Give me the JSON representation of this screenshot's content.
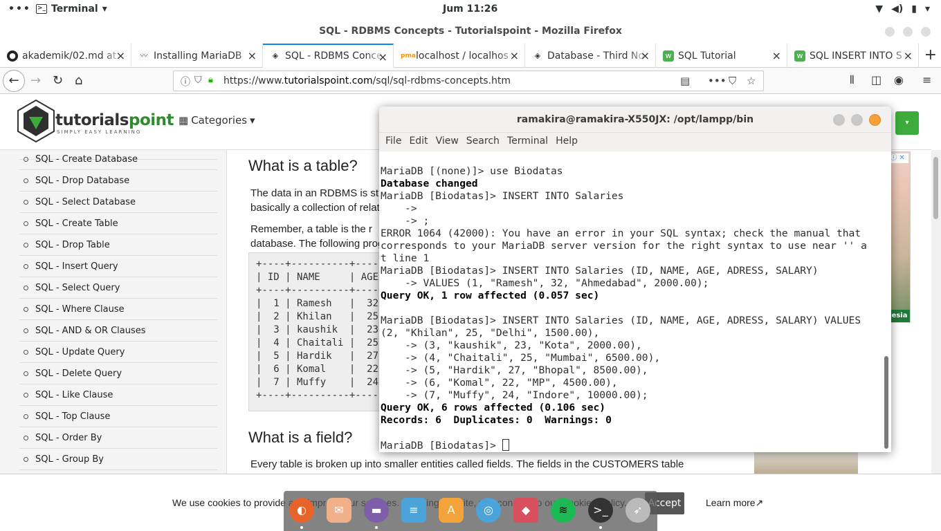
{
  "topbar": {
    "dots": "•••",
    "app_name": "Terminal",
    "clock": "Jum 11:26"
  },
  "firefox": {
    "window_title": "SQL - RDBMS Concepts - Tutorialspoint - Mozilla Firefox",
    "tabs": [
      {
        "label": "akademik/02.md at"
      },
      {
        "label": "Installing MariaDB"
      },
      {
        "label": "SQL - RDBMS Conce"
      },
      {
        "label": "localhost / localhos"
      },
      {
        "label": "Database - Third No"
      },
      {
        "label": "SQL Tutorial"
      },
      {
        "label": "SQL INSERT INTO S"
      }
    ],
    "url_prefix": "https://www.",
    "url_domain": "tutorialspoint.com",
    "url_path": "/sql/sql-rdbms-concepts.htm"
  },
  "site": {
    "logo_word_a": "tutorials",
    "logo_word_b": "point",
    "logo_tag": "SIMPLY EASY LEARNING",
    "categories": "Categories",
    "sidebar": [
      "SQL - Create Database",
      "SQL - Drop Database",
      "SQL - Select Database",
      "SQL - Create Table",
      "SQL - Drop Table",
      "SQL - Insert Query",
      "SQL - Select Query",
      "SQL - Where Clause",
      "SQL - AND & OR Clauses",
      "SQL - Update Query",
      "SQL - Delete Query",
      "SQL - Like Clause",
      "SQL - Top Clause",
      "SQL - Order By",
      "SQL - Group By"
    ],
    "heading_table": "What is a table?",
    "para1_line1": "The data in an RDBMS is st",
    "para1_line2": "basically a collection of relate",
    "para2_line1": "Remember, a table is the r",
    "para2_line2": "database. The following prog",
    "code_lines": [
      "+----+----------+-----",
      "| ID | NAME     | AGE",
      "+----+----------+-----",
      "|  1 | Ramesh   |  32",
      "|  2 | Khilan   |  25",
      "|  3 | kaushik  |  23",
      "|  4 | Chaitali |  25",
      "|  5 | Hardik   |  27",
      "|  6 | Komal    |  22",
      "|  7 | Muffy    |  24",
      "+----+----------+-----"
    ],
    "heading_field": "What is a field?",
    "para3": "Every table is broken up into smaller entities called fields. The fields in the CUSTOMERS table",
    "ad_label": "esia"
  },
  "cookie": {
    "message": "We use cookies to provide and improve our services. By using our site, you consent to our Cookies Policy.",
    "accept": "Accept",
    "learn_more": "Learn more"
  },
  "terminal": {
    "title": "ramakira@ramakira-X550JX: /opt/lampp/bin",
    "menu": [
      "File",
      "Edit",
      "View",
      "Search",
      "Terminal",
      "Help"
    ],
    "lines": [
      "MariaDB [(none)]> use Biodatas",
      "Database changed",
      "MariaDB [Biodatas]> INSERT INTO Salaries",
      "    ->",
      "    -> ;",
      "ERROR 1064 (42000): You have an error in your SQL syntax; check the manual that",
      "corresponds to your MariaDB server version for the right syntax to use near '' a",
      "t line 1",
      "MariaDB [Biodatas]> INSERT INTO Salaries (ID, NAME, AGE, ADRESS, SALARY)",
      "    -> VALUES (1, \"Ramesh\", 32, \"Ahmedabad\", 2000.00);",
      "Query OK, 1 row affected (0.057 sec)",
      "",
      "MariaDB [Biodatas]> INSERT INTO Salaries (ID, NAME, AGE, ADRESS, SALARY) VALUES",
      "(2, \"Khilan\", 25, \"Delhi\", 1500.00),",
      "    -> (3, \"kaushik\", 23, \"Kota\", 2000.00),",
      "    -> (4, \"Chaitali\", 25, \"Mumbai\", 6500.00),",
      "    -> (5, \"Hardik\", 27, \"Bhopal\", 8500.00),",
      "    -> (6, \"Komal\", 22, \"MP\", 4500.00),",
      "    -> (7, \"Muffy\", 24, \"Indore\", 10000.00);",
      "Query OK, 6 rows affected (0.106 sec)",
      "Records: 6  Duplicates: 0  Warnings: 0",
      "",
      "MariaDB [Biodatas]> "
    ]
  },
  "dock": [
    "firefox-icon",
    "mail-icon",
    "files-icon",
    "document-icon",
    "software-icon",
    "help-icon",
    "cube-icon",
    "spotify-icon",
    "terminal-icon",
    "launcher-icon"
  ]
}
